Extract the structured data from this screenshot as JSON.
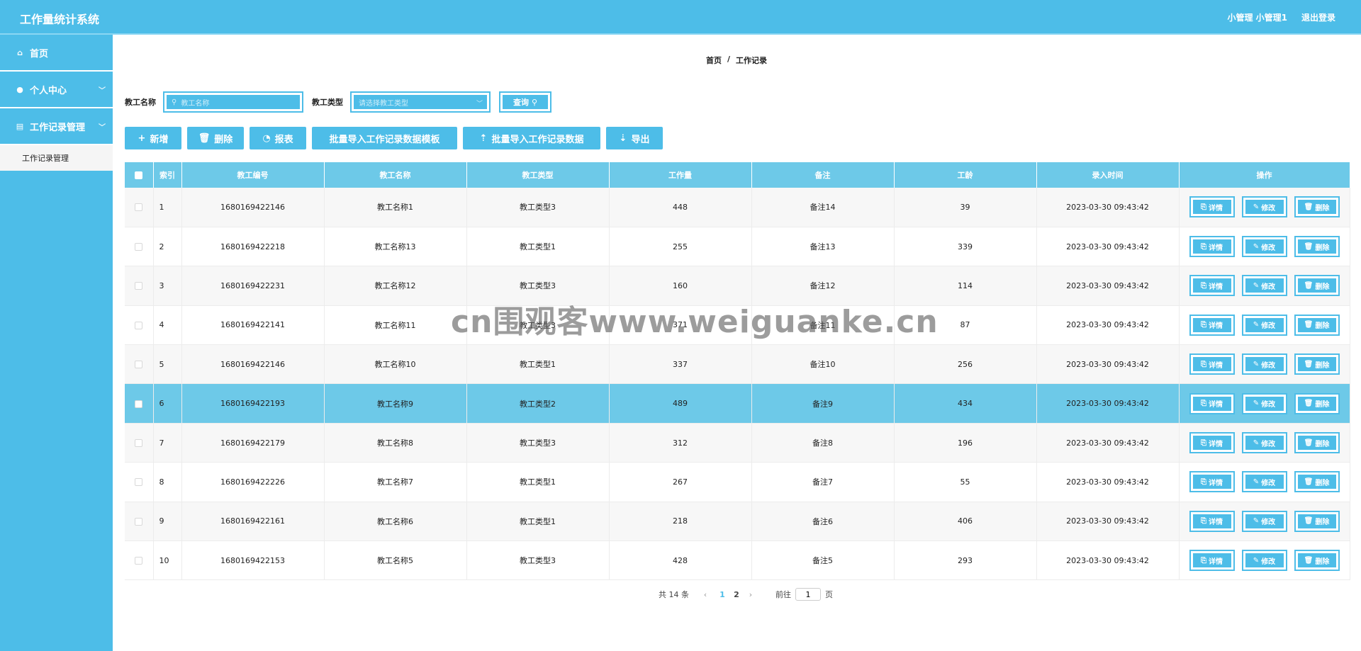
{
  "header": {
    "title": "工作量统计系统",
    "user": "小管理 小管理1",
    "logout": "退出登录"
  },
  "sidebar": {
    "items": [
      {
        "label": "首页",
        "icon": "home-icon"
      },
      {
        "label": "个人中心",
        "icon": "user-icon"
      },
      {
        "label": "工作记录管理",
        "icon": "document-icon"
      }
    ],
    "submenu": {
      "label": "工作记录管理"
    }
  },
  "breadcrumb": {
    "home": "首页",
    "sep": "/",
    "current": "工作记录"
  },
  "search": {
    "name_label": "教工名称",
    "name_placeholder": "教工名称",
    "type_label": "教工类型",
    "type_placeholder": "请选择教工类型",
    "query_label": "查询"
  },
  "actions": {
    "add": "新增",
    "delete": "删除",
    "report": "报表",
    "import_template": "批量导入工作记录数据模板",
    "import_data": "批量导入工作记录数据",
    "export": "导出"
  },
  "table": {
    "headers": [
      "索引",
      "教工编号",
      "教工名称",
      "教工类型",
      "工作量",
      "备注",
      "工龄",
      "录入时间",
      "操作"
    ],
    "rows": [
      [
        "1",
        "1680169422146",
        "教工名称1",
        "教工类型3",
        "448",
        "备注14",
        "39",
        "2023-03-30 09:43:42"
      ],
      [
        "2",
        "1680169422218",
        "教工名称13",
        "教工类型1",
        "255",
        "备注13",
        "339",
        "2023-03-30 09:43:42"
      ],
      [
        "3",
        "1680169422231",
        "教工名称12",
        "教工类型3",
        "160",
        "备注12",
        "114",
        "2023-03-30 09:43:42"
      ],
      [
        "4",
        "1680169422141",
        "教工名称11",
        "教工类型3",
        "371",
        "备注11",
        "87",
        "2023-03-30 09:43:42"
      ],
      [
        "5",
        "1680169422146",
        "教工名称10",
        "教工类型1",
        "337",
        "备注10",
        "256",
        "2023-03-30 09:43:42"
      ],
      [
        "6",
        "1680169422193",
        "教工名称9",
        "教工类型2",
        "489",
        "备注9",
        "434",
        "2023-03-30 09:43:42"
      ],
      [
        "7",
        "1680169422179",
        "教工名称8",
        "教工类型3",
        "312",
        "备注8",
        "196",
        "2023-03-30 09:43:42"
      ],
      [
        "8",
        "1680169422226",
        "教工名称7",
        "教工类型1",
        "267",
        "备注7",
        "55",
        "2023-03-30 09:43:42"
      ],
      [
        "9",
        "1680169422161",
        "教工名称6",
        "教工类型1",
        "218",
        "备注6",
        "406",
        "2023-03-30 09:43:42"
      ],
      [
        "10",
        "1680169422153",
        "教工名称5",
        "教工类型3",
        "428",
        "备注5",
        "293",
        "2023-03-30 09:43:42"
      ]
    ],
    "ops": {
      "detail": "详情",
      "edit": "修改",
      "delete": "删除"
    }
  },
  "pager": {
    "total": "共 14 条",
    "pages": [
      "1",
      "2"
    ],
    "goto_label": "前往",
    "goto_value": "1",
    "page_unit": "页"
  },
  "watermark": "cn围观客www.weiguanke.cn",
  "colors": {
    "accent": "#4dbde8",
    "header_row": "#6dc9e8"
  }
}
